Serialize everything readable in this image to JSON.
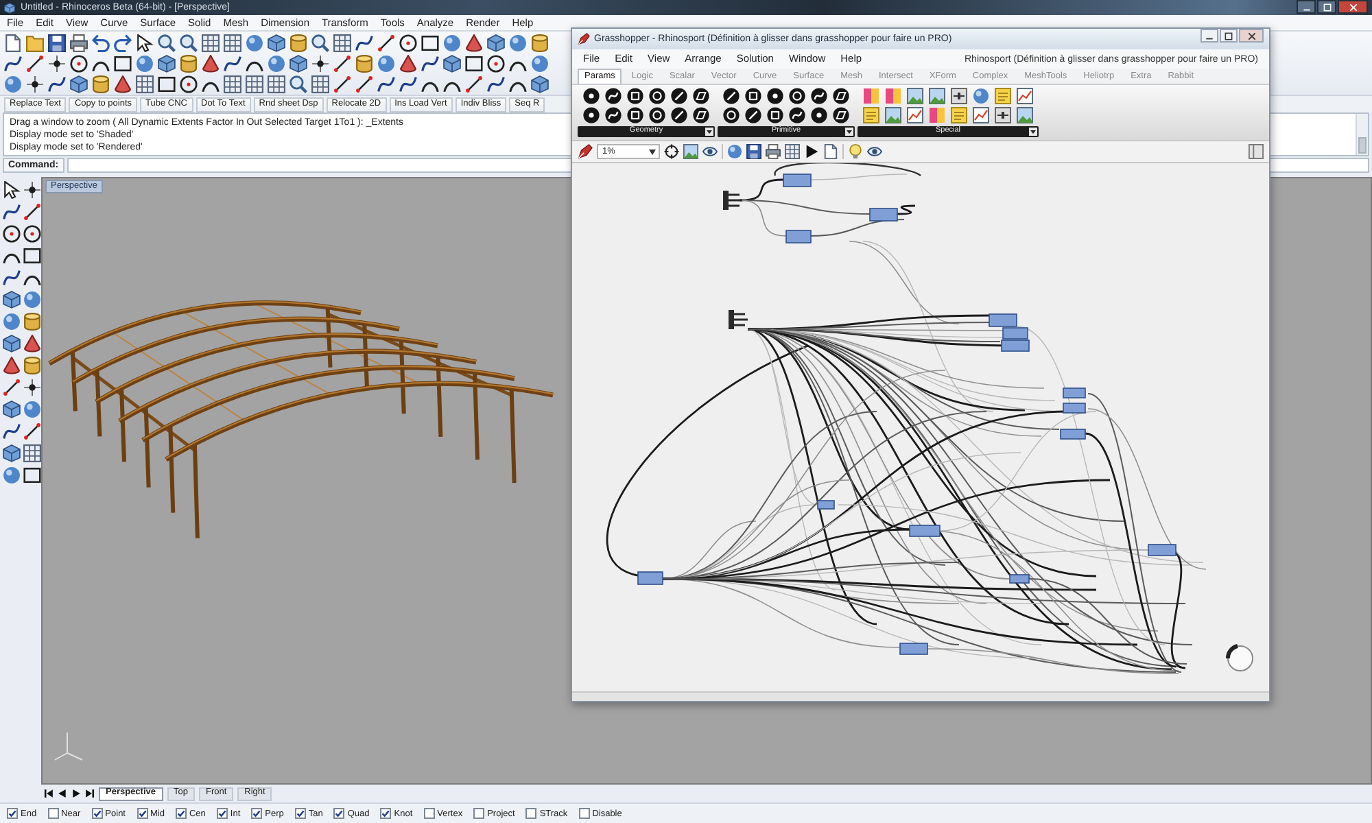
{
  "rhino": {
    "title": "Untitled - Rhinoceros Beta (64-bit) - [Perspective]",
    "menu": [
      "File",
      "Edit",
      "View",
      "Curve",
      "Surface",
      "Solid",
      "Mesh",
      "Dimension",
      "Transform",
      "Tools",
      "Analyze",
      "Render",
      "Help"
    ],
    "command_buttons": [
      "Replace Text",
      "Copy to points",
      "Tube CNC",
      "Dot To Text",
      "Rnd sheet Dsp",
      "Relocate 2D",
      "Ins Load Vert",
      "Indiv Bliss",
      "Seq R"
    ],
    "command_history": [
      "Drag a window to zoom ( All Dynamic Extents Factor In Out Selected Target 1To1 ): _Extents",
      "Display mode set to 'Shaded'",
      "Display mode set to 'Rendered'"
    ],
    "command_prompt": "Command:",
    "viewport": {
      "title": "Perspective"
    },
    "viewport_tabs": [
      {
        "label": "Perspective",
        "selected": true
      },
      {
        "label": "Top",
        "selected": false
      },
      {
        "label": "Front",
        "selected": false
      },
      {
        "label": "Right",
        "selected": false
      }
    ],
    "osnaps": [
      {
        "label": "End",
        "checked": true
      },
      {
        "label": "Near",
        "checked": false
      },
      {
        "label": "Point",
        "checked": true
      },
      {
        "label": "Mid",
        "checked": true
      },
      {
        "label": "Cen",
        "checked": true
      },
      {
        "label": "Int",
        "checked": true
      },
      {
        "label": "Perp",
        "checked": true
      },
      {
        "label": "Tan",
        "checked": true
      },
      {
        "label": "Quad",
        "checked": true
      },
      {
        "label": "Knot",
        "checked": true
      },
      {
        "label": "Vertex",
        "checked": false
      },
      {
        "label": "Project",
        "checked": false
      },
      {
        "label": "STrack",
        "checked": false
      },
      {
        "label": "Disable",
        "checked": false
      }
    ]
  },
  "grasshopper": {
    "title": "Grasshopper - Rhinosport (Définition à glisser dans grasshopper pour faire un PRO)",
    "menu": [
      "File",
      "Edit",
      "View",
      "Arrange",
      "Solution",
      "Window",
      "Help"
    ],
    "document_name": "Rhinosport (Définition à glisser dans grasshopper pour faire un PRO)",
    "tabs": [
      {
        "label": "Params",
        "selected": true
      },
      {
        "label": "Logic",
        "selected": false
      },
      {
        "label": "Scalar",
        "selected": false
      },
      {
        "label": "Vector",
        "selected": false
      },
      {
        "label": "Curve",
        "selected": false
      },
      {
        "label": "Surface",
        "selected": false
      },
      {
        "label": "Mesh",
        "selected": false
      },
      {
        "label": "Intersect",
        "selected": false
      },
      {
        "label": "XForm",
        "selected": false
      },
      {
        "label": "Complex",
        "selected": false
      },
      {
        "label": "MeshTools",
        "selected": false
      },
      {
        "label": "Heliotrp",
        "selected": false
      },
      {
        "label": "Extra",
        "selected": false
      },
      {
        "label": "Rabbit",
        "selected": false
      }
    ],
    "panel_groups": [
      "Geometry",
      "Primitive",
      "Special"
    ],
    "zoom": "1%"
  }
}
